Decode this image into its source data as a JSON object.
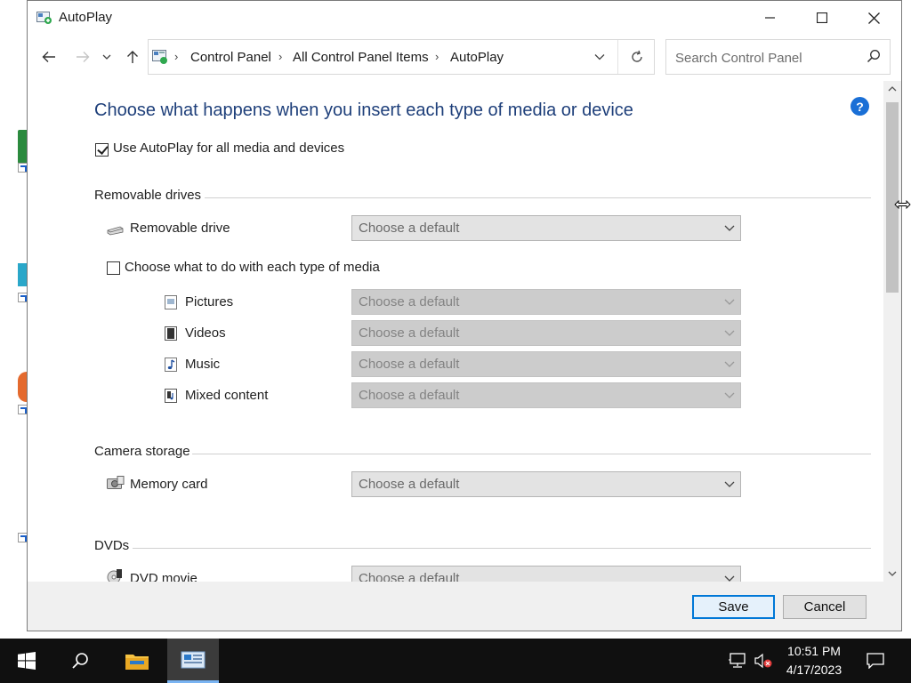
{
  "window": {
    "title": "AutoPlay"
  },
  "address_bar": {
    "crumbs": [
      "Control Panel",
      "All Control Panel Items",
      "AutoPlay"
    ]
  },
  "search": {
    "placeholder": "Search Control Panel"
  },
  "content": {
    "heading": "Choose what happens when you insert each type of media or device",
    "use_autoplay": {
      "label": "Use AutoPlay for all media and devices",
      "checked": true
    },
    "removable_drives": {
      "title": "Removable drives",
      "removable_drive": {
        "label": "Removable drive",
        "value": "Choose a default"
      },
      "per_media": {
        "label": "Choose what to do with each type of media",
        "checked": false
      },
      "media": [
        {
          "label": "Pictures",
          "value": "Choose a default"
        },
        {
          "label": "Videos",
          "value": "Choose a default"
        },
        {
          "label": "Music",
          "value": "Choose a default"
        },
        {
          "label": "Mixed content",
          "value": "Choose a default"
        }
      ]
    },
    "camera_storage": {
      "title": "Camera storage",
      "memory_card": {
        "label": "Memory card",
        "value": "Choose a default"
      }
    },
    "dvds": {
      "title": "DVDs",
      "dvd_movie": {
        "label": "DVD movie",
        "value": "Choose a default"
      }
    }
  },
  "footer": {
    "save_label": "Save",
    "cancel_label": "Cancel"
  },
  "taskbar": {
    "time": "10:51 PM",
    "date": "4/17/2023"
  },
  "colors": {
    "heading": "#1e3f7a",
    "accent": "#0078d7",
    "help": "#1a6fd6",
    "taskbar": "#101010"
  },
  "icons": [
    "app-icon",
    "back-icon",
    "forward-icon",
    "recent-icon",
    "up-icon",
    "control-panel-icon",
    "refresh-icon",
    "search-icon",
    "help-icon",
    "removable-drive-icon",
    "pictures-icon",
    "videos-icon",
    "music-icon",
    "mixed-content-icon",
    "memory-card-icon",
    "dvd-icon",
    "start-icon",
    "file-explorer-icon",
    "network-icon",
    "volume-muted-icon",
    "notification-icon"
  ]
}
